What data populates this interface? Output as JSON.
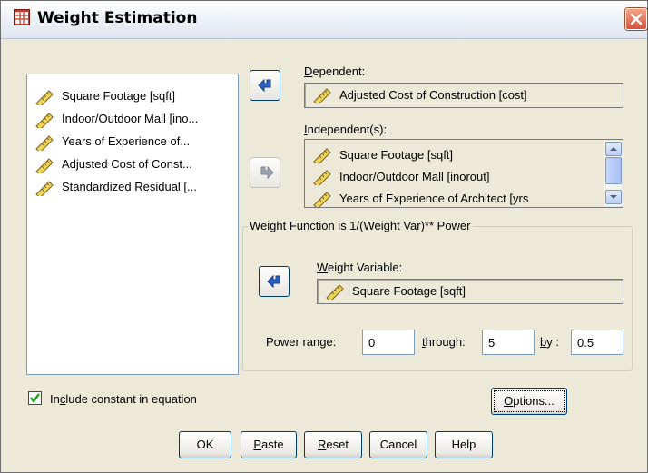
{
  "window": {
    "title": "Weight Estimation",
    "title_icon": "table-grid-icon",
    "close_icon": "close-icon"
  },
  "source_list": {
    "items": [
      {
        "label": "Square Footage [sqft]",
        "icon": "scale-ruler-icon"
      },
      {
        "label": "Indoor/Outdoor Mall [ino...",
        "icon": "scale-ruler-icon"
      },
      {
        "label": "Years of Experience of...",
        "icon": "scale-ruler-icon"
      },
      {
        "label": "Adjusted Cost of Const...",
        "icon": "scale-ruler-icon"
      },
      {
        "label": "Standardized Residual [...",
        "icon": "scale-ruler-icon"
      }
    ]
  },
  "dependent": {
    "label_prefix": "D",
    "label_rest": "ependent:",
    "value": "Adjusted Cost of Construction [cost]"
  },
  "independents": {
    "label_prefix": "I",
    "label_rest": "ndependent(s):",
    "items": [
      "Square Footage [sqft]",
      "Indoor/Outdoor Mall [inorout]",
      "Years of Experience of Architect [yrs"
    ]
  },
  "weight_function": {
    "legend": "Weight Function is 1/(Weight Var)** Power",
    "variable_label_prefix": "W",
    "variable_label_rest": "eight Variable:",
    "variable_value": "Square Footage [sqft]",
    "power_range_label_pre": "Power ran",
    "power_range_label_u": "g",
    "power_range_label_post": "e:",
    "power_from": "0",
    "through_label_pre": "",
    "through_label_u": "t",
    "through_label_post": "hrough:",
    "power_to": "5",
    "by_label_pre": "",
    "by_label_u": "b",
    "by_label_post": "y :",
    "power_step": "0.5"
  },
  "include_constant": {
    "checked": true,
    "label_pre": "In",
    "label_u": "c",
    "label_post": "lude constant in equation"
  },
  "buttons": {
    "options_pre": "",
    "options_u": "O",
    "options_post": "ptions...",
    "ok": "OK",
    "paste_u": "P",
    "paste_post": "aste",
    "reset_u": "R",
    "reset_post": "eset",
    "cancel": "Cancel",
    "help": "Help"
  },
  "colors": {
    "dialog_bg": "#ece9d8",
    "arrow_blue": "#2a64c8",
    "title_icon_red": "#c23a2a",
    "close_red": "#d8533a"
  }
}
